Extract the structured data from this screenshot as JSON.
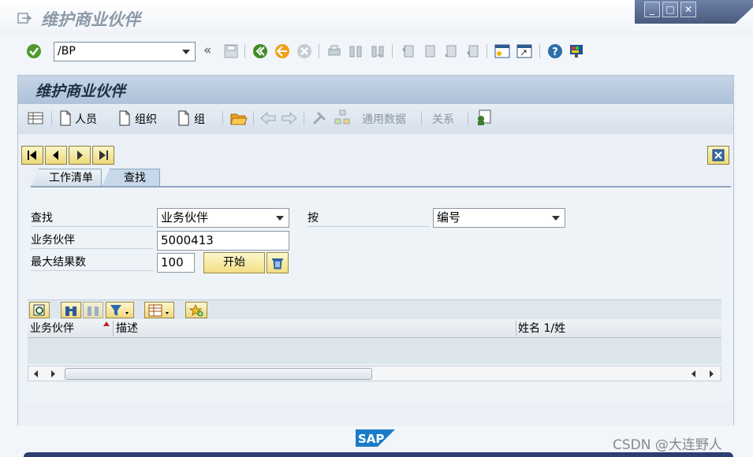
{
  "window": {
    "title": "维护商业伙伴",
    "controls": [
      "minimize",
      "maximize",
      "close"
    ]
  },
  "system_toolbar": {
    "command_field": {
      "value": "/BP"
    },
    "icons": [
      "enter-icon",
      "save-icon",
      "back-icon",
      "exit-icon",
      "cancel-icon",
      "print-icon",
      "find-icon",
      "find-next-icon",
      "first-page-icon",
      "previous-page-icon",
      "next-page-icon",
      "last-page-icon",
      "new-session-icon",
      "shortcut-icon",
      "help-icon",
      "customize-layout-icon"
    ],
    "collapse_glyph": "«"
  },
  "screen": {
    "title": "维护商业伙伴",
    "app_toolbar": {
      "person": "人员",
      "organization": "组织",
      "group": "组",
      "general_data": "通用数据",
      "relationships": "关系"
    },
    "tabs": [
      {
        "label": "工作清单",
        "active": false
      },
      {
        "label": "查找",
        "active": true
      }
    ],
    "search": {
      "find_label": "查找",
      "find_value": "业务伙伴",
      "by_label": "按",
      "by_value": "编号",
      "bp_label": "业务伙伴",
      "bp_value": "5000413",
      "max_label": "最大结果数",
      "max_value": "100",
      "start_button": "开始"
    },
    "result_grid": {
      "columns": [
        "业务伙伴",
        "描述",
        "姓名 1/姓"
      ],
      "rows": []
    }
  },
  "footer": {
    "sap_logo": "SAP",
    "watermark": "CSDN @大连野人"
  }
}
